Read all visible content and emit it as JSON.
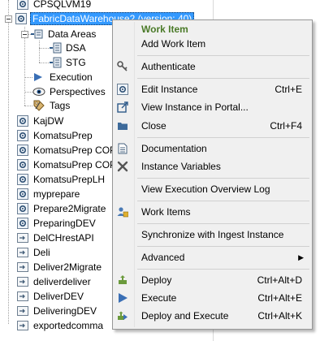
{
  "tree": {
    "nodes": [
      {
        "label": "CPSQLVM19",
        "icon": "gear-icon"
      },
      {
        "label": "FabricDataWarehouse2 (version: 40)",
        "icon": "gear-icon"
      },
      {
        "label": "Data Areas",
        "icon": "data-areas-icon"
      },
      {
        "label": "DSA",
        "icon": "data-area-icon"
      },
      {
        "label": "STG",
        "icon": "data-area-icon"
      },
      {
        "label": "Execution",
        "icon": "execution-icon"
      },
      {
        "label": "Perspectives",
        "icon": "eye-icon"
      },
      {
        "label": "Tags",
        "icon": "tags-icon"
      },
      {
        "label": "KajDW",
        "icon": "gear-icon"
      },
      {
        "label": "KomatsuPrep",
        "icon": "gear-icon"
      },
      {
        "label": "KomatsuPrep COPY",
        "icon": "gear-icon"
      },
      {
        "label": "KomatsuPrep COPY2",
        "icon": "gear-icon"
      },
      {
        "label": "KomatsuPrepLH",
        "icon": "gear-icon"
      },
      {
        "label": "myprepare",
        "icon": "gear-icon"
      },
      {
        "label": "Prepare2Migrate",
        "icon": "gear-icon"
      },
      {
        "label": "PreparingDEV",
        "icon": "gear-icon"
      },
      {
        "label": "DelCHrestAPI",
        "icon": "deliver-icon"
      },
      {
        "label": "Deli",
        "icon": "deliver-icon"
      },
      {
        "label": "Deliver2Migrate",
        "icon": "deliver-icon"
      },
      {
        "label": "deliverdeliver",
        "icon": "deliver-icon"
      },
      {
        "label": "DeliverDEV",
        "icon": "deliver-icon"
      },
      {
        "label": "DeliveringDEV",
        "icon": "deliver-icon"
      },
      {
        "label": "exportedcomma",
        "icon": "deliver-icon"
      }
    ]
  },
  "menu": {
    "header": "Work Item",
    "items": [
      {
        "label": "Add Work Item",
        "shortcut": "",
        "icon": ""
      },
      {
        "label": "Authenticate",
        "shortcut": "",
        "icon": "key-icon"
      },
      {
        "label": "Edit Instance",
        "shortcut": "Ctrl+E",
        "icon": "gear-icon"
      },
      {
        "label": "View Instance in Portal...",
        "shortcut": "",
        "icon": "external-link-icon"
      },
      {
        "label": "Close",
        "shortcut": "Ctrl+F4",
        "icon": "folder-icon"
      },
      {
        "label": "Documentation",
        "shortcut": "",
        "icon": "document-icon"
      },
      {
        "label": "Instance Variables",
        "shortcut": "",
        "icon": "variable-x-icon"
      },
      {
        "label": "View Execution Overview Log",
        "shortcut": "",
        "icon": ""
      },
      {
        "label": "Work Items",
        "shortcut": "",
        "icon": "work-items-icon"
      },
      {
        "label": "Synchronize with Ingest Instance",
        "shortcut": "",
        "icon": ""
      },
      {
        "label": "Advanced",
        "shortcut": "",
        "icon": "",
        "submenu_arrow": "▶"
      },
      {
        "label": "Deploy",
        "shortcut": "Ctrl+Alt+D",
        "icon": "deploy-icon"
      },
      {
        "label": "Execute",
        "shortcut": "Ctrl+Alt+E",
        "icon": "play-icon"
      },
      {
        "label": "Deploy and Execute",
        "shortcut": "Ctrl+Alt+K",
        "icon": "deploy-execute-icon"
      }
    ]
  },
  "colors": {
    "selection": "#3399ff",
    "menu_bg": "#f0f0f0",
    "header_green": "#4a7a28",
    "deploy_green": "#6b9a3c",
    "play_blue": "#3a6fb5"
  }
}
